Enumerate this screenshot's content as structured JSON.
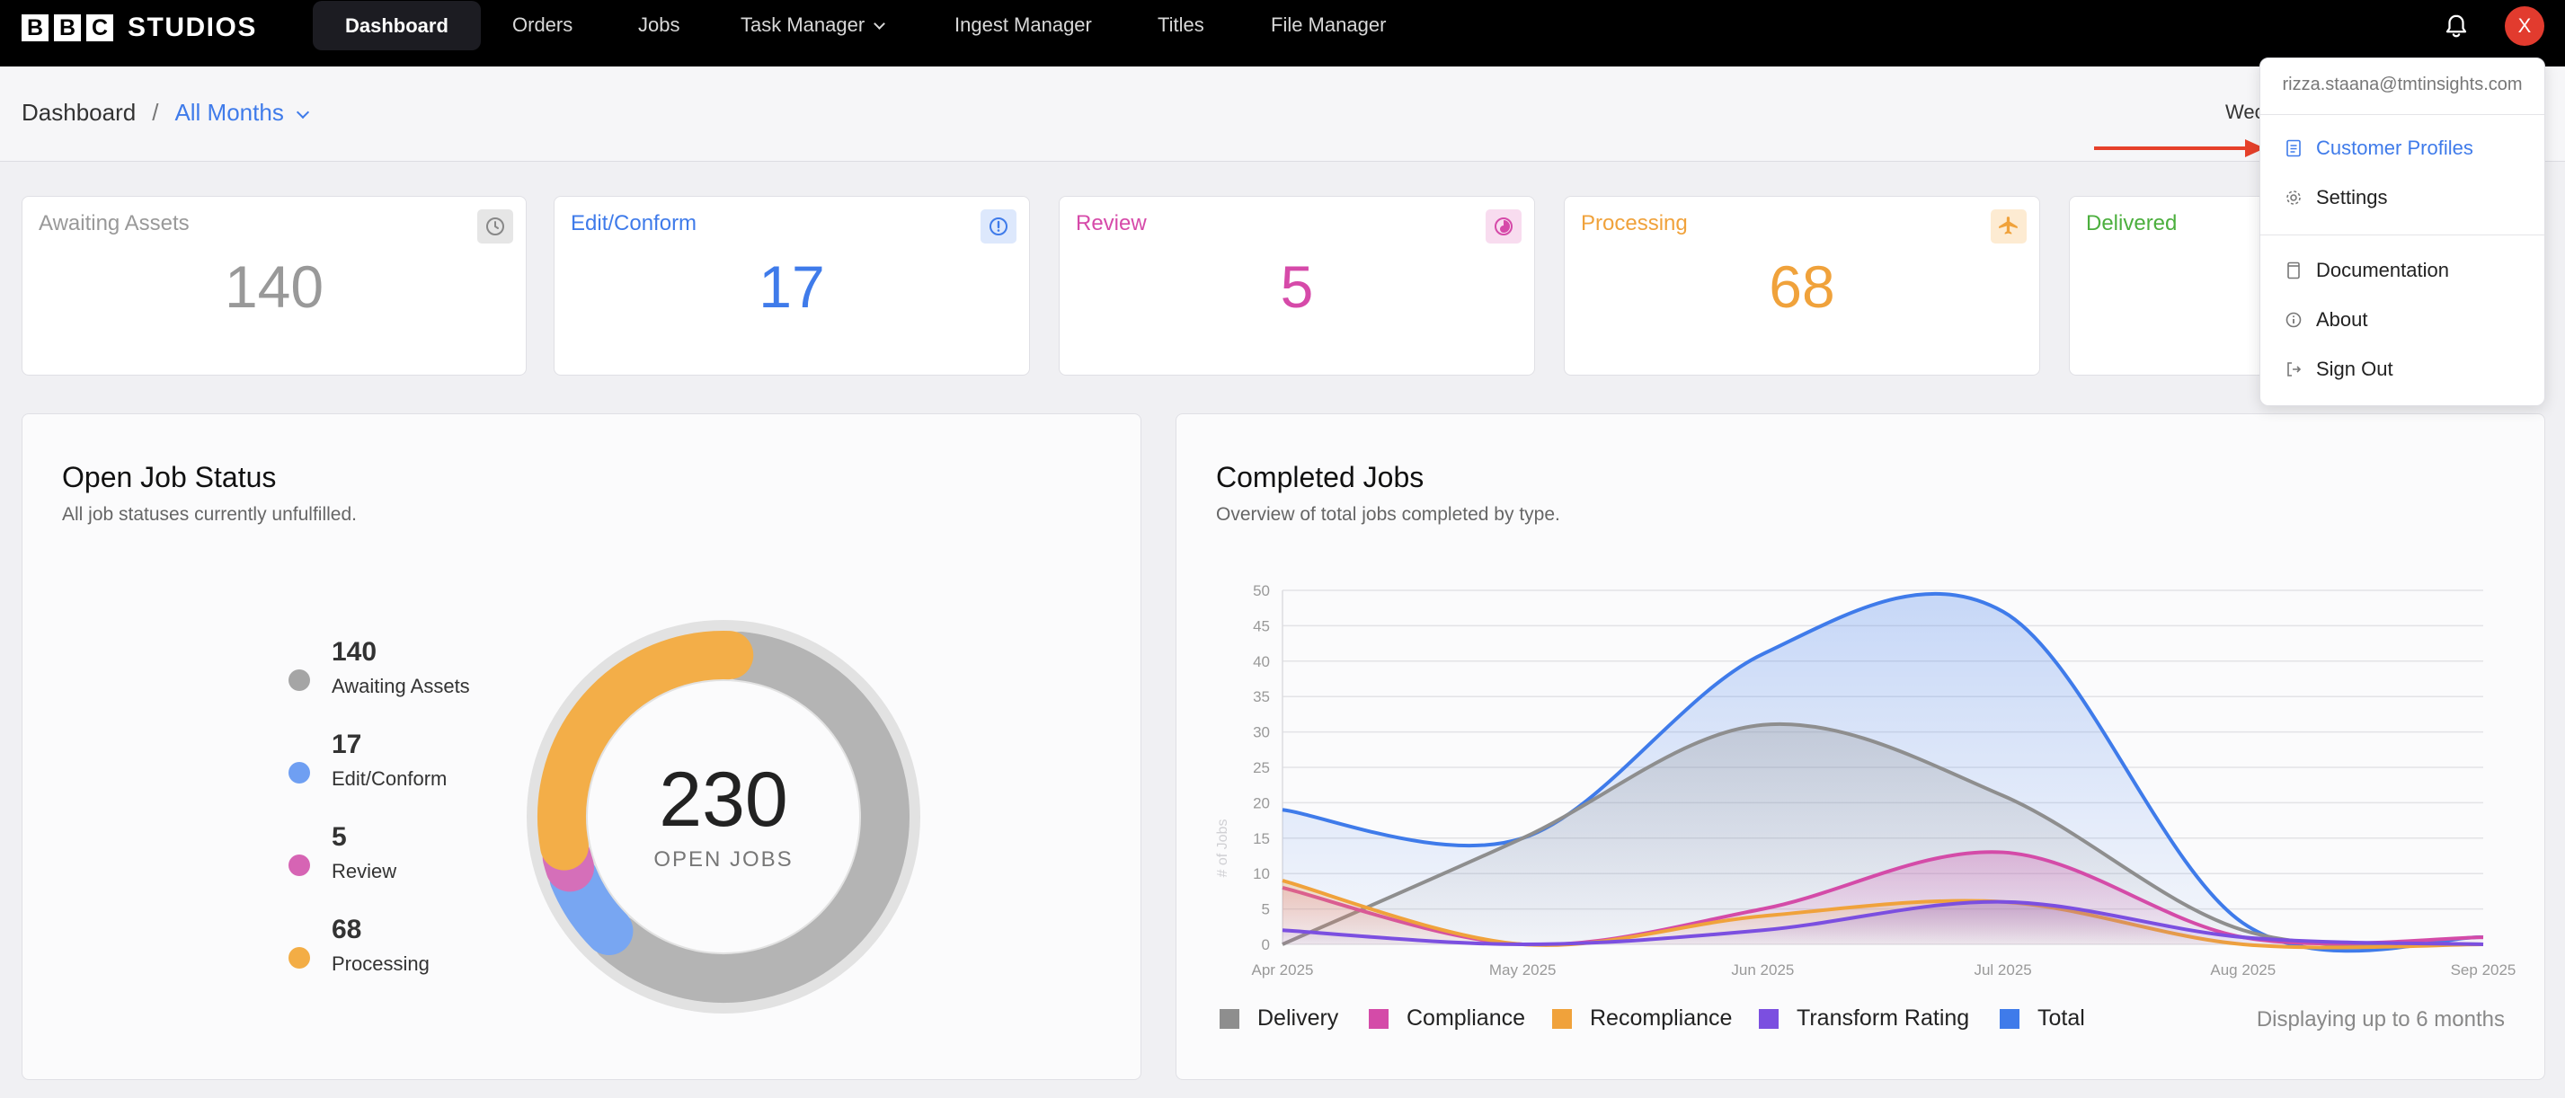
{
  "brand": {
    "letters": [
      "B",
      "B",
      "C"
    ],
    "name": "STUDIOS"
  },
  "nav": {
    "dashboard": "Dashboard",
    "orders": "Orders",
    "jobs": "Jobs",
    "task_manager": "Task Manager",
    "ingest_manager": "Ingest Manager",
    "titles": "Titles",
    "file_manager": "File Manager"
  },
  "user": {
    "initial": "X",
    "email": "rizza.staana@tmtinsights.com"
  },
  "breadcrumb": {
    "root": "Dashboard",
    "separator": "/",
    "period": "All Months"
  },
  "date_fragment": "Wec",
  "stats": [
    {
      "label": "Awaiting Assets",
      "value": "140",
      "color": "#999999",
      "icon": "clock-icon"
    },
    {
      "label": "Edit/Conform",
      "value": "17",
      "color": "#3f7bea",
      "icon": "info-icon"
    },
    {
      "label": "Review",
      "value": "5",
      "color": "#d64aa9",
      "icon": "review-icon"
    },
    {
      "label": "Processing",
      "value": "68",
      "color": "#f0a23b",
      "icon": "airplane-icon"
    },
    {
      "label": "Delivered",
      "value": "",
      "color": "#4caf3e",
      "icon": ""
    }
  ],
  "open_job_status": {
    "title": "Open Job Status",
    "subtitle": "All job statuses currently unfulfilled.",
    "legend": [
      {
        "value": "140",
        "label": "Awaiting Assets",
        "color": "#a5a5a5"
      },
      {
        "value": "17",
        "label": "Edit/Conform",
        "color": "#6f9ff2"
      },
      {
        "value": "5",
        "label": "Review",
        "color": "#d664b4"
      },
      {
        "value": "68",
        "label": "Processing",
        "color": "#f3ad45"
      }
    ],
    "total": "230",
    "total_label": "OPEN JOBS"
  },
  "completed_jobs": {
    "title": "Completed Jobs",
    "subtitle": "Overview of total jobs completed by type.",
    "note": "Displaying up to 6 months"
  },
  "chart_data": [
    {
      "type": "pie",
      "categories": [
        "Awaiting Assets",
        "Edit/Conform",
        "Review",
        "Processing"
      ],
      "values": [
        140,
        17,
        5,
        68
      ],
      "colors": [
        "#b4b4b4",
        "#78a6f2",
        "#d56fb9",
        "#f3ae48"
      ],
      "total": 230
    },
    {
      "type": "area",
      "x": [
        "Apr 2025",
        "May 2025",
        "Jun 2025",
        "Jul 2025",
        "Aug 2025",
        "Sep 2025"
      ],
      "ylabel": "# of Jobs",
      "ylim": [
        0,
        50
      ],
      "yticks": [
        0,
        5,
        10,
        15,
        20,
        25,
        30,
        35,
        40,
        45,
        50
      ],
      "grid": true,
      "legend": "bottom-left",
      "series": [
        {
          "name": "Delivery",
          "color": "#8e8e8e",
          "values": [
            0,
            15,
            31,
            21,
            2,
            0
          ]
        },
        {
          "name": "Compliance",
          "color": "#d44ba8",
          "values": [
            8,
            0,
            5,
            13,
            1,
            1
          ]
        },
        {
          "name": "Recompliance",
          "color": "#f0a23b",
          "values": [
            9,
            0,
            4,
            6,
            0,
            0
          ]
        },
        {
          "name": "Transform Rating",
          "color": "#7b4fe0",
          "values": [
            2,
            0,
            2,
            6,
            1,
            0
          ]
        },
        {
          "name": "Total",
          "color": "#3f7bea",
          "values": [
            19,
            15,
            41,
            47,
            3,
            1
          ]
        }
      ]
    }
  ],
  "menu": {
    "customer_profiles": "Customer Profiles",
    "settings": "Settings",
    "documentation": "Documentation",
    "about": "About",
    "sign_out": "Sign Out"
  }
}
